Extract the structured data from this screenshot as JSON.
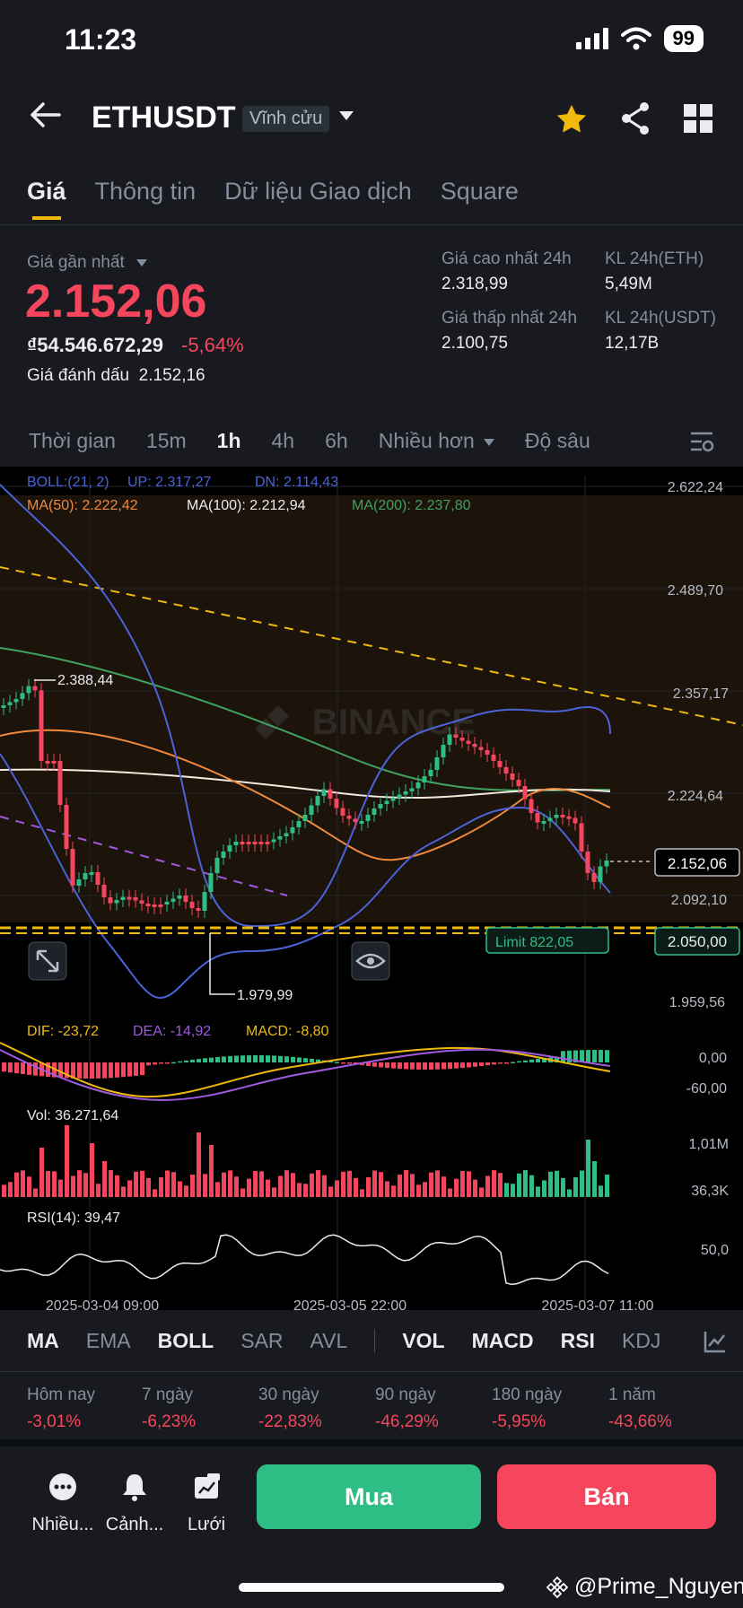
{
  "status": {
    "time": "11:23",
    "battery": "99"
  },
  "header": {
    "symbol": "ETHUSDT",
    "contract": "Vĩnh cửu"
  },
  "tabs": [
    {
      "label": "Giá"
    },
    {
      "label": "Thông tin"
    },
    {
      "label": "Dữ liệu Giao dịch"
    },
    {
      "label": "Square"
    }
  ],
  "price": {
    "last_label": "Giá gần nhất",
    "last": "2.152,06",
    "vnd": "₫54.546.672,29",
    "change_pct": "-5,64%",
    "mark_label": "Giá đánh dấu",
    "mark": "2.152,16"
  },
  "stats": {
    "high_label": "Giá cao nhất 24h",
    "high": "2.318,99",
    "low_label": "Giá thấp nhất 24h",
    "low": "2.100,75",
    "vol_eth_label": "KL 24h(ETH)",
    "vol_eth": "5,49M",
    "vol_usdt_label": "KL 24h(USDT)",
    "vol_usdt": "12,17B"
  },
  "intervals": {
    "time": "Thời gian",
    "i15m": "15m",
    "i1h": "1h",
    "i4h": "4h",
    "i6h": "6h",
    "more": "Nhiều hơn",
    "depth": "Độ sâu"
  },
  "chart": {
    "boll": "BOLL:(21, 2)",
    "up": "UP: 2.317,27",
    "dn": "DN: 2.114,43",
    "ma50": "MA(50): 2.222,42",
    "ma100": "MA(100): 2.212,94",
    "ma200": "MA(200): 2.237,80",
    "watermark": "BINANCE",
    "high_mark": "2.388,44",
    "low_mark": "1.979,99",
    "y_labels": [
      "2.622,24",
      "2.489,70",
      "2.357,17",
      "2.224,64",
      "2.092,10",
      "1.959,56"
    ],
    "current_price": "2.152,06",
    "limit_label": "Limit  822,05",
    "limit_price": "2.050,00",
    "dif": "DIF: -23,72",
    "dea": "DEA: -14,92",
    "macd": "MACD: -8,80",
    "macd_labels": [
      "0,00",
      "-60,00"
    ],
    "vol": "Vol: 36.271,64",
    "vol_labels": [
      "1,01M",
      "36,3K"
    ],
    "rsi": "RSI(14): 39,47",
    "rsi_label": "50,0",
    "x_labels": [
      "2025-03-04 09:00",
      "2025-03-05 22:00",
      "2025-03-07 11:00"
    ]
  },
  "indicators": [
    "MA",
    "EMA",
    "BOLL",
    "SAR",
    "AVL",
    "VOL",
    "MACD",
    "RSI",
    "KDJ"
  ],
  "performance": [
    {
      "label": "Hôm nay",
      "value": "-3,01%"
    },
    {
      "label": "7 ngày",
      "value": "-6,23%"
    },
    {
      "label": "30 ngày",
      "value": "-22,83%"
    },
    {
      "label": "90 ngày",
      "value": "-46,29%"
    },
    {
      "label": "180 ngày",
      "value": "-5,95%"
    },
    {
      "label": "1 năm",
      "value": "-43,66%"
    }
  ],
  "bottom": {
    "more": "Nhiều...",
    "alert": "Cảnh...",
    "grid": "Lưới",
    "buy": "Mua",
    "sell": "Bán"
  },
  "watermark_user": "@Prime_Nguyen",
  "colors": {
    "up": "#2ebd85",
    "down": "#f6465d",
    "accent": "#f0b90b",
    "bg": "#181a20"
  }
}
